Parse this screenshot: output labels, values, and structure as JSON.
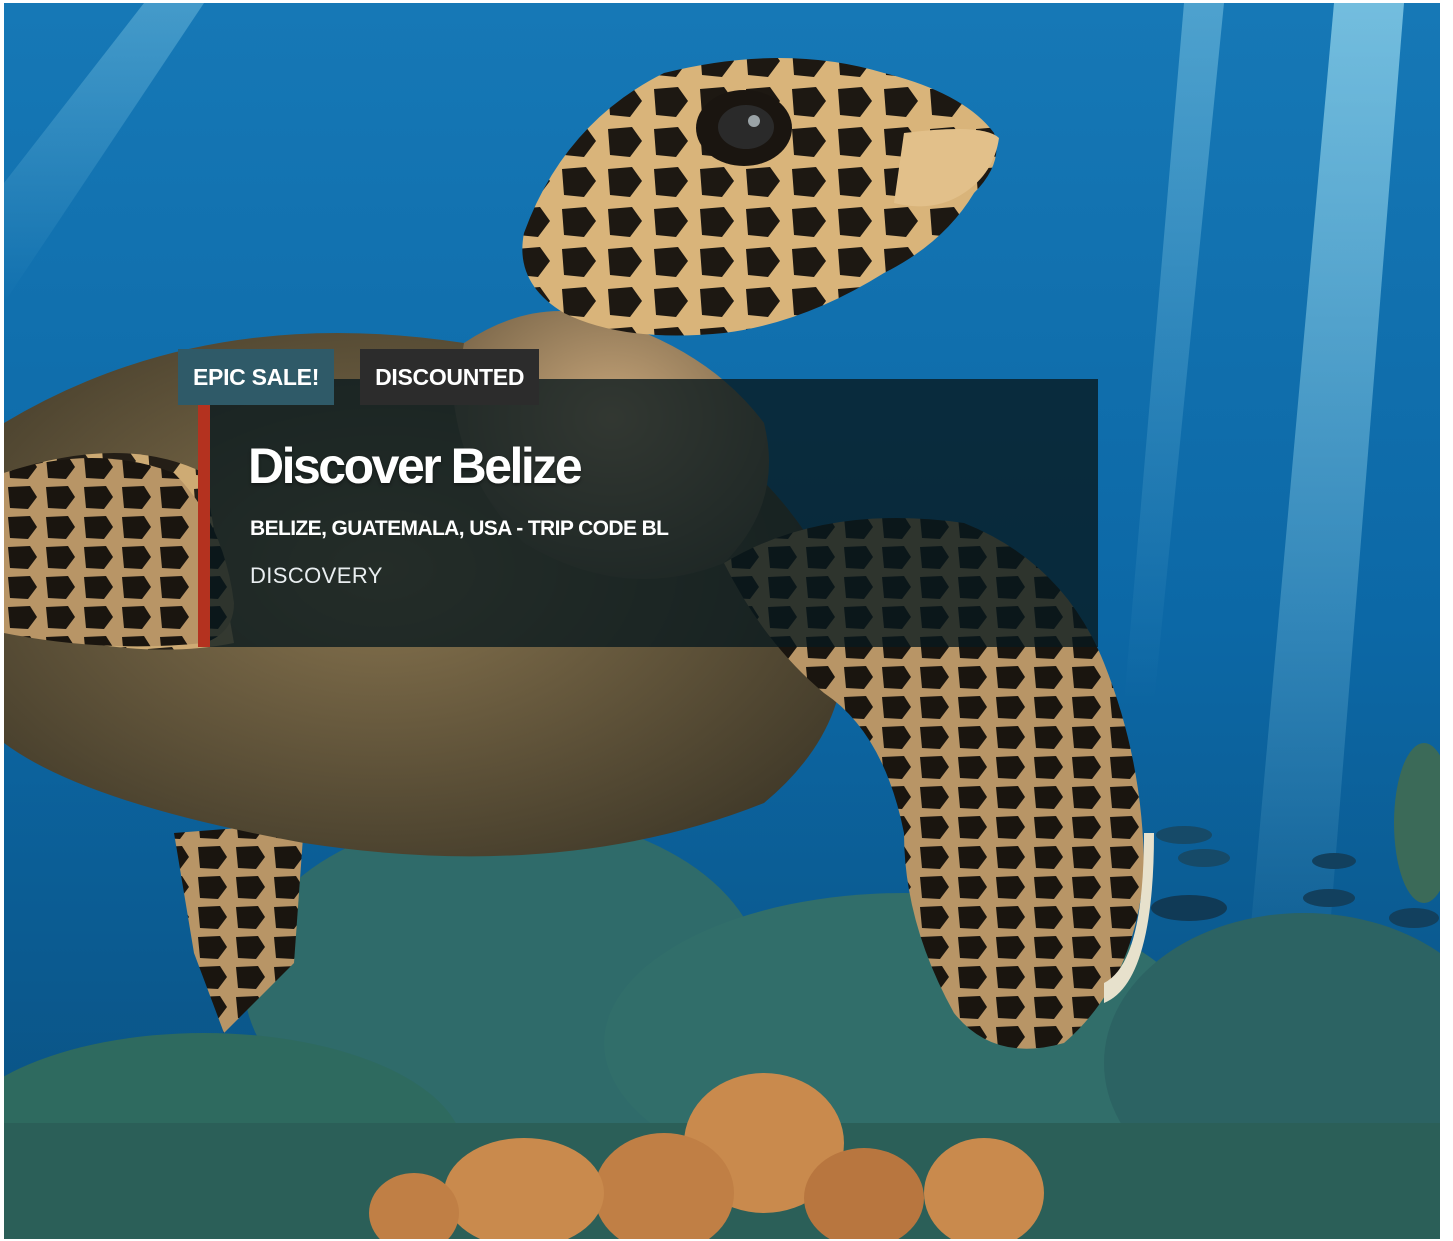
{
  "card": {
    "badges": {
      "sale": "EPIC SALE!",
      "discount": "DISCOUNTED"
    },
    "title": "Discover Belize",
    "subtitle": "BELIZE, GUATEMALA, USA - TRIP CODE BL",
    "style": "DISCOVERY",
    "image": {
      "subject": "sea-turtle-over-coral-reef",
      "alt": ""
    }
  },
  "colors": {
    "sale_badge": "#2f5a68",
    "discount_badge": "#2c2c2c",
    "accent_bar": "#b4321f",
    "panel_overlay": "#08181e",
    "water": "#0f6aa8"
  }
}
